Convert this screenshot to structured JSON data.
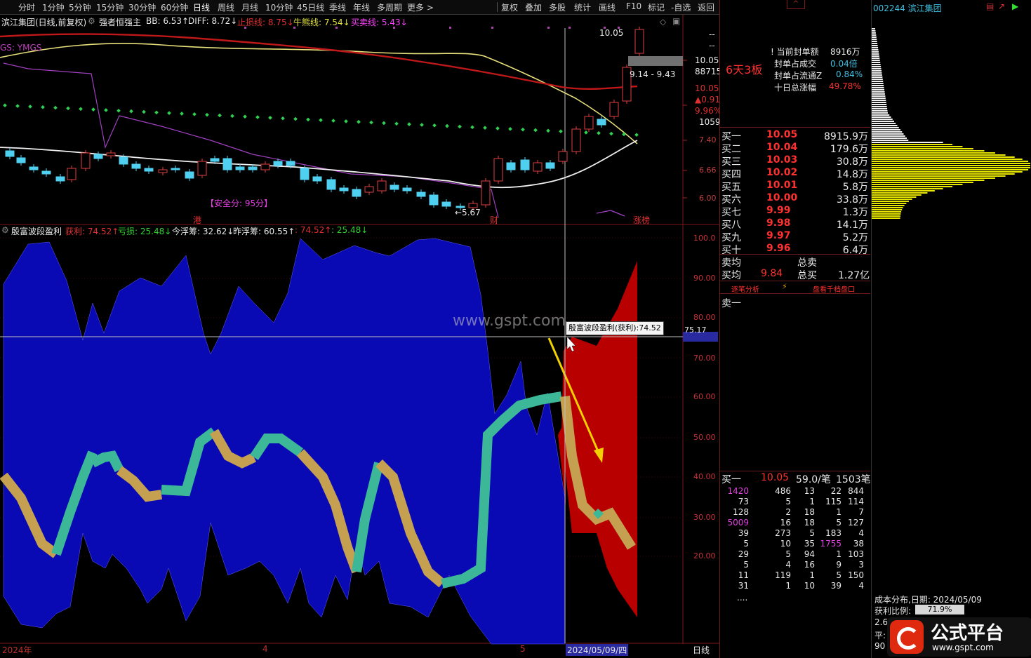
{
  "toolbar": {
    "periods": [
      "分时",
      "1分钟",
      "5分钟",
      "15分钟",
      "30分钟",
      "60分钟",
      "日线",
      "周线",
      "月线",
      "10分钟",
      "45日线",
      "季线",
      "年线",
      "多周期",
      "更多 >"
    ],
    "tools": [
      "复权",
      "叠加",
      "多股",
      "统计",
      "画线",
      "F10",
      "标记",
      "-自选",
      "返回"
    ]
  },
  "main": {
    "title": "滨江集团(日线,前复权)",
    "indicator": "强者恒强主",
    "bb": "BB: 6.53↑",
    "diff": "DIFF: 8.72↓",
    "stoploss": "止损线: 8.75↓",
    "bull": "牛熊线: 7.54↓",
    "buysell": "买卖线: 5.43↓",
    "ymgs": "GS: YMGS",
    "safety": "【安全分: 95分】",
    "low_note": "←5.67",
    "tag_gang": "港",
    "tag_cai": "财",
    "tag_zhangbang": "涨榜",
    "high_note": "10.05",
    "range_note": "9.14 - 9.43",
    "price_axis": [
      "10.05",
      "88715",
      "10.05",
      "▲0.91",
      "9.96%",
      "1059",
      "7.40",
      "6.66",
      "6.00"
    ]
  },
  "sub": {
    "title": "殷富波段盈利",
    "profit": "获利: 74.52↑",
    "loss": "亏损: 25.48↓",
    "float_today": "今浮筹: 32.62↓",
    "float_yest": "昨浮筹: 60.55↑",
    "v1": ": 74.52↑",
    "v2": ": 25.48↓",
    "tooltip": "殷富波段盈利(获利):74.52",
    "cursor_val": "75.17",
    "yaxis": [
      "100.0",
      "90.00",
      "80.00",
      "70.00",
      "60.00",
      "50.00",
      "40.00",
      "30.00",
      "20.00"
    ],
    "watermark": "www.gspt.com"
  },
  "xaxis": {
    "y2024": "2024年",
    "m4": "4",
    "m5": "5",
    "cursor_date": "2024/05/09/四",
    "period": "日线"
  },
  "right": {
    "header_btn": "^",
    "board": "6天3板",
    "seal_amount_label": "当前封单额",
    "seal_amount": "8916万",
    "seal_deal_label": "封单占成交",
    "seal_deal": "0.04倍",
    "seal_float_label": "封单占流通Z",
    "seal_float": "0.84%",
    "ten_day_label": "十日总涨幅",
    "ten_day": "49.78%",
    "bids": [
      {
        "label": "买一",
        "price": "10.05",
        "vol": "8915.9万"
      },
      {
        "label": "买二",
        "price": "10.04",
        "vol": "179.6万"
      },
      {
        "label": "买三",
        "price": "10.03",
        "vol": "30.8万"
      },
      {
        "label": "买四",
        "price": "10.02",
        "vol": "14.8万"
      },
      {
        "label": "买五",
        "price": "10.01",
        "vol": "5.8万"
      },
      {
        "label": "买六",
        "price": "10.00",
        "vol": "33.8万"
      },
      {
        "label": "买七",
        "price": "9.99",
        "vol": "1.3万"
      },
      {
        "label": "买八",
        "price": "9.98",
        "vol": "14.1万"
      },
      {
        "label": "买九",
        "price": "9.97",
        "vol": "5.2万"
      },
      {
        "label": "买十",
        "price": "9.96",
        "vol": "6.4万"
      }
    ],
    "avg_sell_label": "卖均",
    "total_sell_label": "总卖",
    "avg_buy_label": "买均",
    "avg_buy": "9.84",
    "total_buy_label": "总买",
    "total_buy": "1.27亿",
    "link1": "逐笔分析",
    "link2": "盘看千档盘口",
    "sell1": "卖一",
    "queue_head": {
      "label": "买一",
      "price": "10.05",
      "per": "59.0/笔",
      "count": "1503笔"
    },
    "queue": [
      [
        "1420",
        "486",
        "13",
        "22",
        "844"
      ],
      [
        "73",
        "5",
        "1",
        "115",
        "114"
      ],
      [
        "128",
        "2",
        "18",
        "1",
        "7"
      ],
      [
        "5009",
        "16",
        "18",
        "5",
        "127"
      ],
      [
        "39",
        "273",
        "5",
        "183",
        "4"
      ],
      [
        "5",
        "10",
        "35",
        "1755",
        "38"
      ],
      [
        "29",
        "5",
        "94",
        "1",
        "103"
      ],
      [
        "5",
        "4",
        "16",
        "9",
        "3"
      ],
      [
        "11",
        "119",
        "1",
        "5",
        "150"
      ],
      [
        "31",
        "1",
        "10",
        "39",
        "4"
      ]
    ],
    "more": "...."
  },
  "far": {
    "code": "002244 滨江集团",
    "cost_title": "成本分布,日期: 2024/05/09",
    "profit_ratio_label": "获利比例:",
    "profit_ratio": "71.9%",
    "r1": "2.6",
    "r2": "平:",
    "r3": "90",
    "brand": "公式平台",
    "brand_url": "www.gspt.com"
  }
}
